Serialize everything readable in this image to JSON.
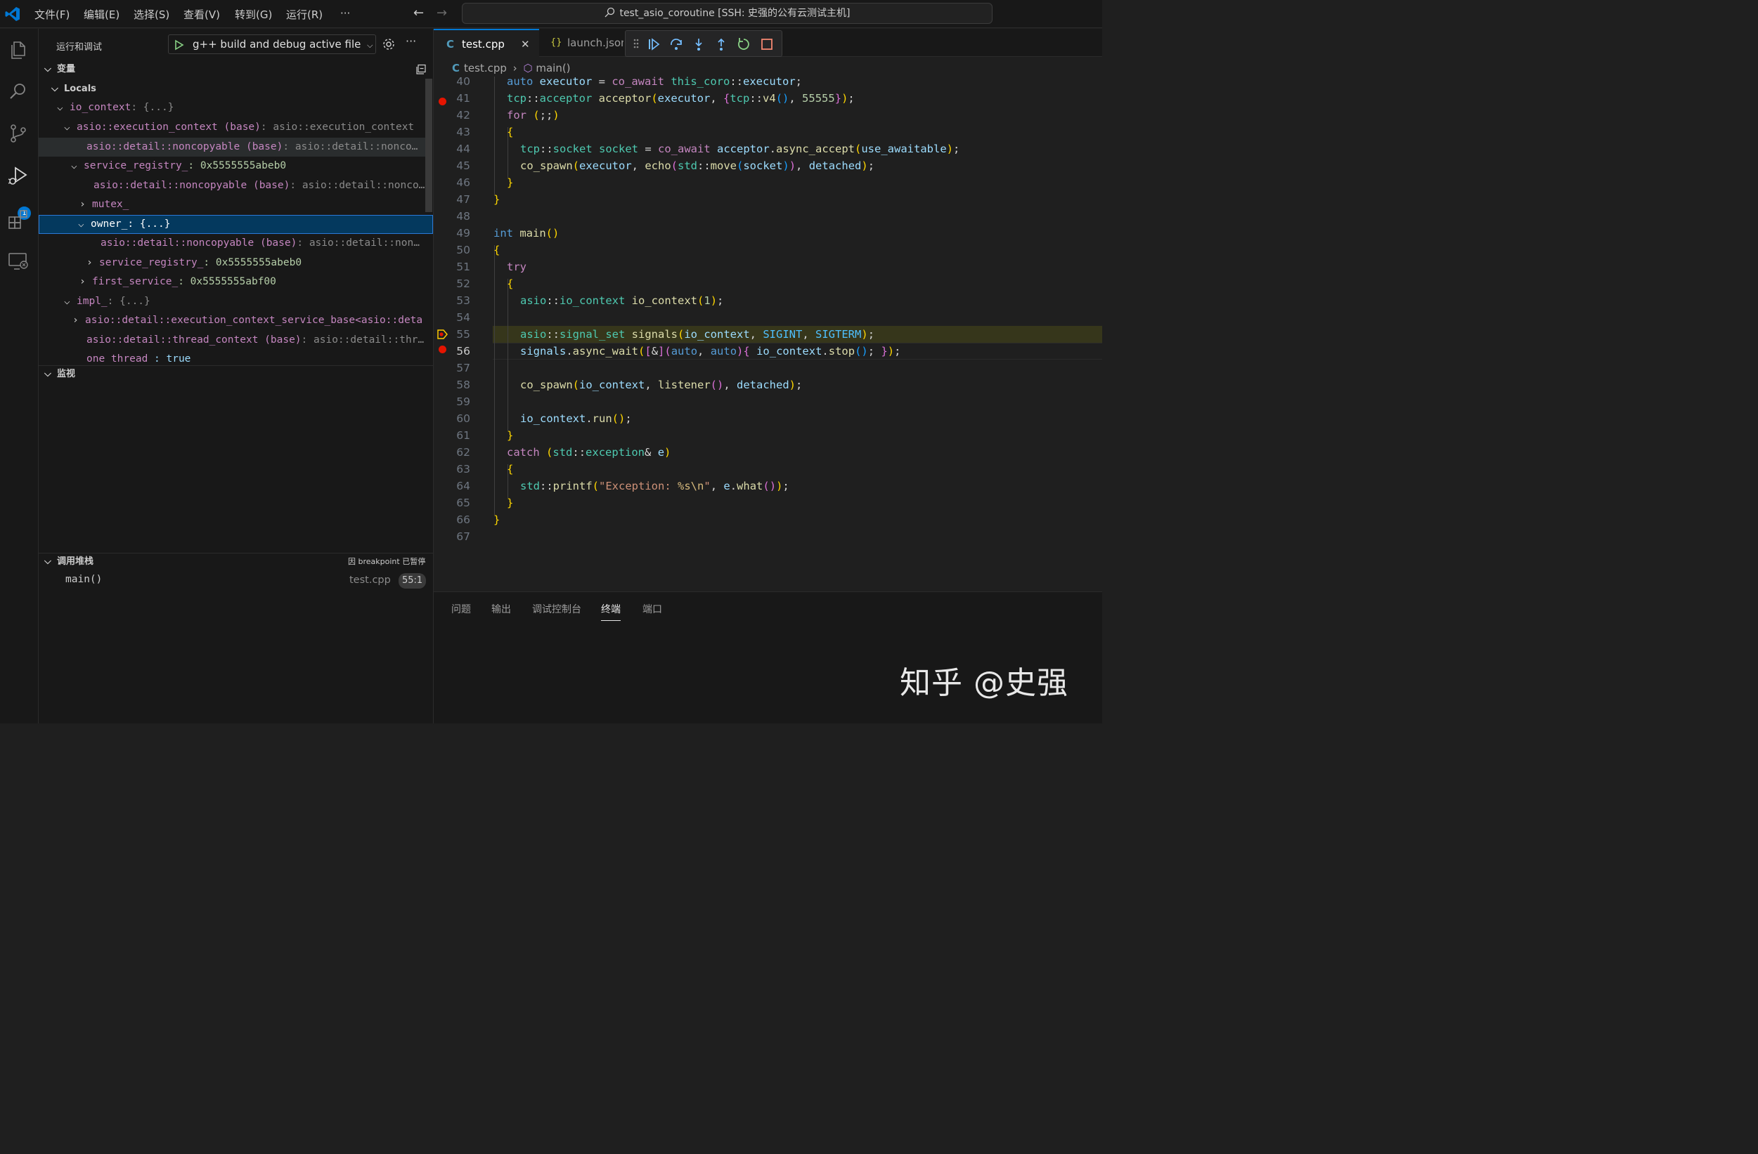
{
  "menu": [
    "文件(F)",
    "编辑(E)",
    "选择(S)",
    "查看(V)",
    "转到(G)",
    "运行(R)",
    "···"
  ],
  "search": {
    "text": "test_asio_coroutine [SSH: 史强的公有云测试主机]"
  },
  "activity_badge": "1",
  "sidebar": {
    "title": "运行和调试",
    "config": "g++ build and debug active file",
    "variables_header": "变量",
    "locals_label": "Locals",
    "rows": [
      {
        "name": "io_context",
        "value": ": {...}"
      },
      {
        "name": "asio::execution_context (base)",
        "value": ": asio::execution_context"
      },
      {
        "name": "asio::detail::noncopyable (base)",
        "value": ": asio::detail::nonco…"
      },
      {
        "name": "service_registry_",
        "value": ": 0x5555555abeb0"
      },
      {
        "name": "asio::detail::noncopyable (base)",
        "value": ": asio::detail::nonco…"
      },
      {
        "name": "mutex_",
        "value": ""
      },
      {
        "name": "owner_",
        "value": ": {...}"
      },
      {
        "name": "asio::detail::noncopyable (base)",
        "value": ": asio::detail::non…"
      },
      {
        "name": "service_registry_",
        "value": ": 0x5555555abeb0"
      },
      {
        "name": "first_service_",
        "value": ": 0x5555555abf00"
      },
      {
        "name": "impl_",
        "value": ": {...}"
      },
      {
        "name": "asio::detail::execution_context_service_base<asio::deta",
        "value": ""
      },
      {
        "name": "asio::detail::thread_context (base)",
        "value": ": asio::detail::thr…"
      },
      {
        "name": "one_thread_",
        "value": ": true"
      }
    ],
    "watch_header": "监视",
    "callstack_header": "调用堆栈",
    "callstack_status": "因 breakpoint 已暂停",
    "frame": {
      "name": "main()",
      "file": "test.cpp",
      "pos": "55:1"
    }
  },
  "tabs": [
    {
      "icon": "C",
      "label": "test.cpp"
    },
    {
      "icon": "{}",
      "label": "launch.json"
    }
  ],
  "breadcrumb": {
    "file": "test.cpp",
    "symbol": "main()"
  },
  "line_numbers": [
    "40",
    "41",
    "42",
    "43",
    "44",
    "45",
    "46",
    "47",
    "48",
    "49",
    "50",
    "51",
    "52",
    "53",
    "54",
    "55",
    "56",
    "57",
    "58",
    "59",
    "60",
    "61",
    "62",
    "63",
    "64",
    "65",
    "66",
    "67"
  ],
  "breakpoint_lines": [
    "41",
    "56"
  ],
  "current_line": "55",
  "code_text": [
    "auto executor = co_await this_coro::executor;",
    "tcp::acceptor acceptor(executor, {tcp::v4(), 55555});",
    "for (;;)",
    "{",
    "tcp::socket socket = co_await acceptor.async_accept(use_awaitable);",
    "co_spawn(executor, echo(std::move(socket)), detached);",
    "}",
    "}",
    "",
    "int main()",
    "{",
    "try",
    "{",
    "asio::io_context io_context(1);",
    "",
    "asio::signal_set signals(io_context, SIGINT, SIGTERM);",
    "signals.async_wait([&](auto, auto){ io_context.stop(); });",
    "",
    "co_spawn(io_context, listener(), detached);",
    "",
    "io_context.run();",
    "}",
    "catch (std::exception& e)",
    "{",
    "std::printf(\"Exception: %s\\n\", e.what());",
    "}",
    "}",
    ""
  ],
  "panel_tabs": [
    "问题",
    "输出",
    "调试控制台",
    "终端",
    "端口"
  ],
  "panel_active": "终端",
  "watermark": "知乎 @史强",
  "colors": {
    "accent": "#0078d4",
    "breakpoint": "#e51400",
    "current_line": "#4b4b18"
  }
}
